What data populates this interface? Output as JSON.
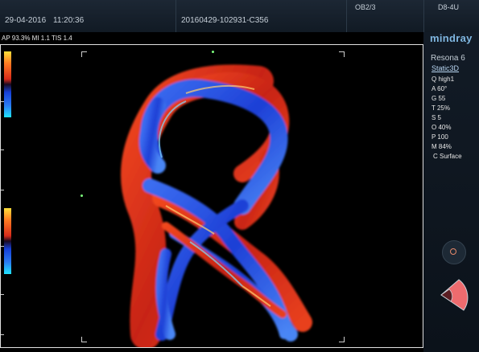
{
  "header": {
    "date": "29-04-2016",
    "time": "11:20:36",
    "exam_id": "20160429-102931-C356",
    "preset": "OB2/3",
    "probe": "D8-4U"
  },
  "status_line": "AP 93.3%  MI 1.1  TIS 1.4",
  "panel": {
    "brand": "mindray",
    "model": "Resona 6",
    "mode": "Static3D",
    "params": [
      "Q high1",
      "A 60°",
      "G 55",
      "T 25%",
      "S 5",
      "O 40%",
      "P 100",
      "M 84%",
      "C Surface"
    ]
  },
  "icons": {
    "knob": "trackball-knob-icon",
    "probe": "probe-sector-icon"
  },
  "colors": {
    "doppler_red": "#e0331f",
    "doppler_blue": "#2f56e8",
    "marker_green": "#7cff7c",
    "brand": "#7fb6e0"
  }
}
